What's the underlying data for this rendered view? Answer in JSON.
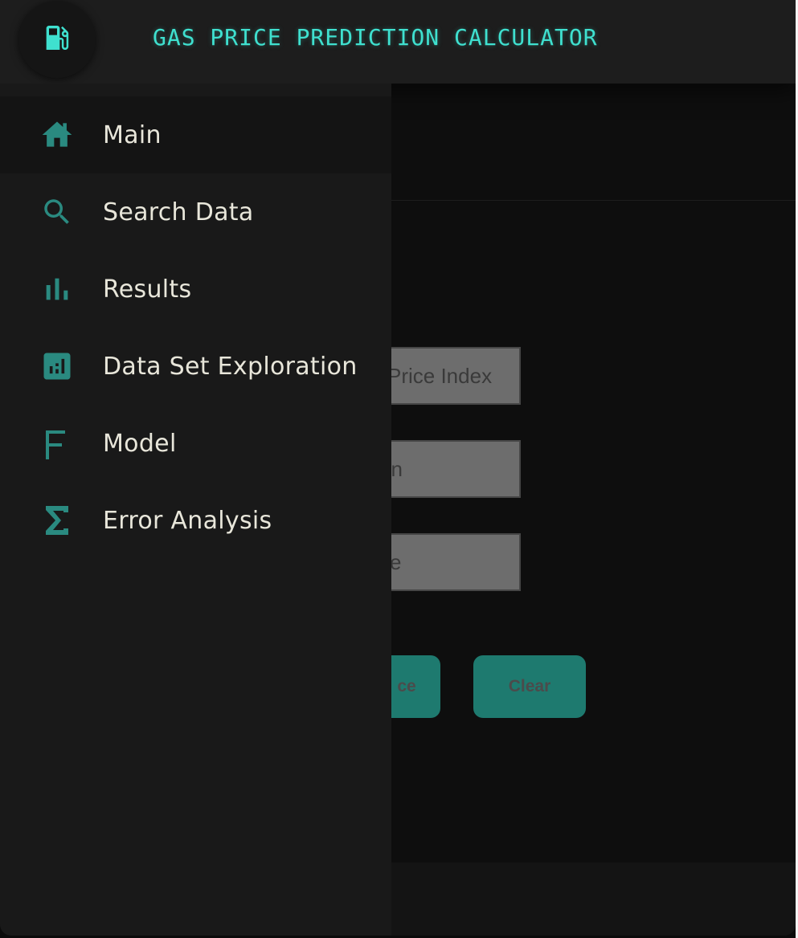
{
  "header": {
    "title": "GAS PRICE PREDICTION CALCULATOR",
    "logo_icon": "gas-pump-icon",
    "accent_color": "#3fe0cf"
  },
  "sidebar": {
    "items": [
      {
        "label": "Main",
        "icon": "home-icon",
        "active": true
      },
      {
        "label": "Search Data",
        "icon": "search-icon",
        "active": false
      },
      {
        "label": "Results",
        "icon": "bar-chart-icon",
        "active": false
      },
      {
        "label": "Data Set Exploration",
        "icon": "analytics-icon",
        "active": false
      },
      {
        "label": "Model",
        "icon": "function-icon",
        "active": false
      },
      {
        "label": "Error Analysis",
        "icon": "sigma-icon",
        "active": false
      }
    ],
    "icon_color": "#2a8a80"
  },
  "form": {
    "fields": [
      {
        "visible_text": "Price Index"
      },
      {
        "visible_text": "on"
      },
      {
        "visible_text": "ce"
      }
    ],
    "predict_label_visible": "ce",
    "clear_label": "Clear",
    "button_color": "#1e7a6f"
  }
}
